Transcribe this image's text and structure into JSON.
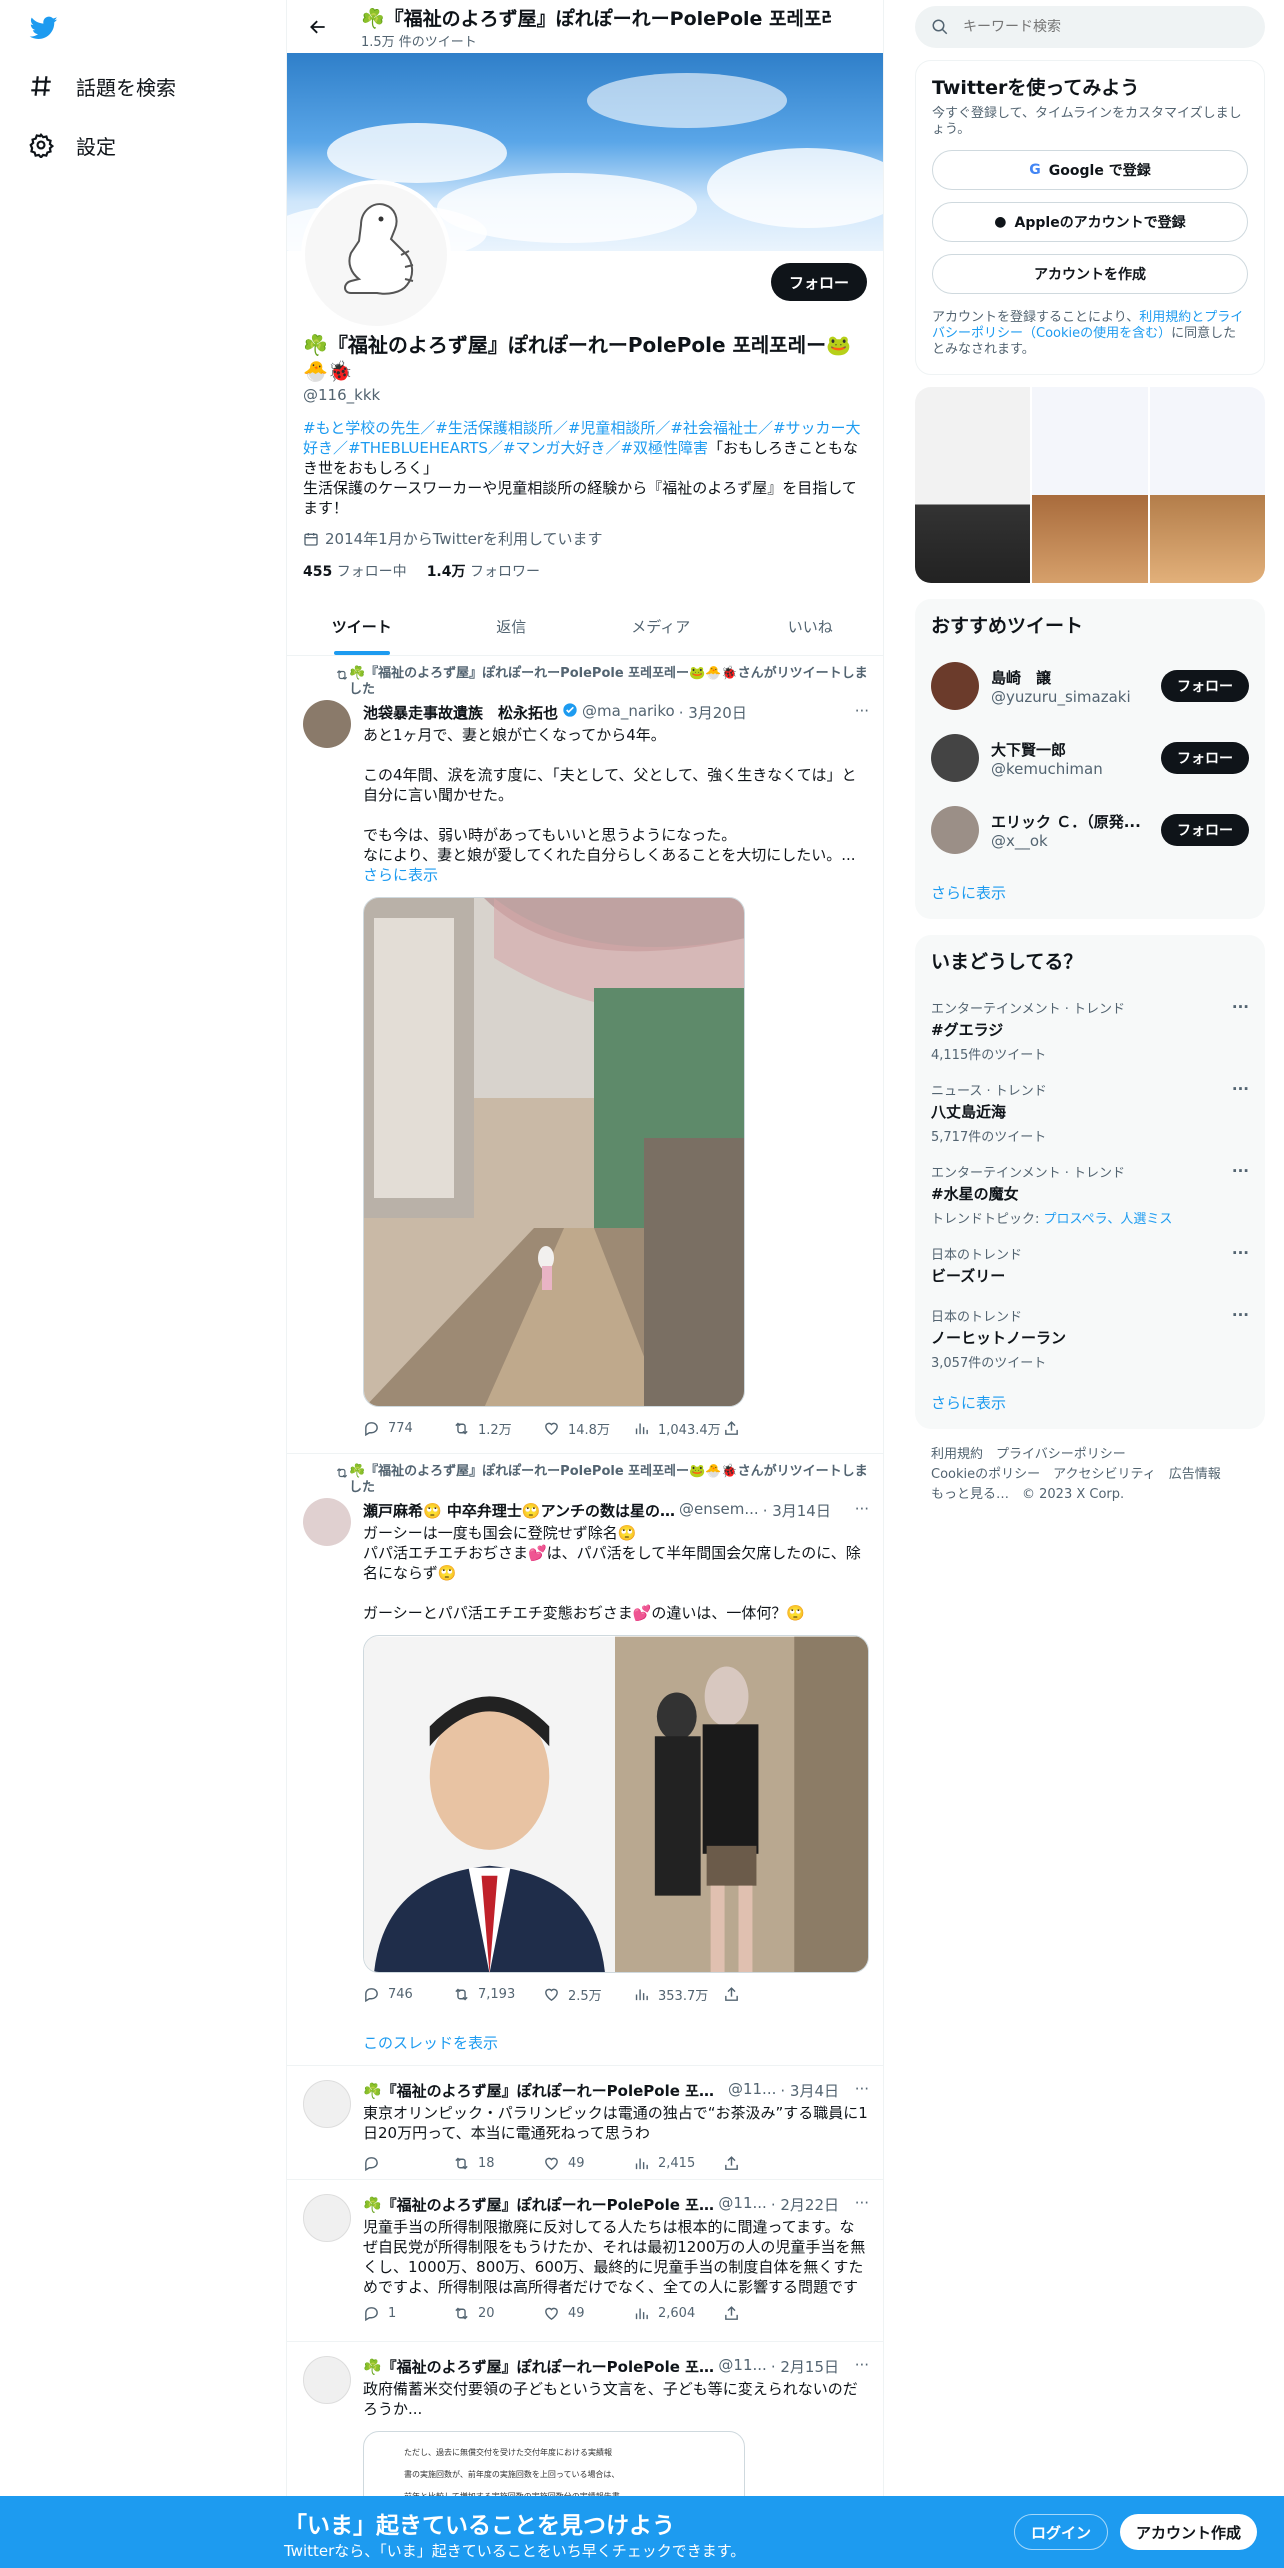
{
  "nav": {
    "explore_label": "話題を検索",
    "settings_label": "設定"
  },
  "header": {
    "name": "☘️『福祉のよろず屋』ぽれぽーれーPolePole 포레포레ー",
    "tweet_count": "1.5万 件のツイート"
  },
  "profile": {
    "name": "☘️『福祉のよろず屋』ぽれぽーれーPolePole 포레포레ー🐸🐣🐞",
    "handle": "@116_kkk",
    "bio_tags": "#もと学校の先生／#生活保護相談所／#児童相談所／#社会福祉士／#サッカー大好き／#THEBLUEHEARTS／#マンガ大好き／#双極性障害",
    "bio_quote": "「おもしろきこともなき世をおもしろく」",
    "bio_text": "生活保護のケースワーカーや児童相談所の経験から『福祉のよろず屋』を目指してます！",
    "joined": "2014年1月からTwitterを利用しています",
    "following_count": "455",
    "following_label": "フォロー中",
    "followers_count": "1.4万",
    "followers_label": "フォロワー",
    "follow_button": "フォロー"
  },
  "tabs": [
    "ツイート",
    "返信",
    "メディア",
    "いいね"
  ],
  "tweets": [
    {
      "retweet_by": "☘️『福祉のよろず屋』ぽれぽーれーPolePole 포레포레ー🐸🐣🐞さんがリツイートしました",
      "name": "池袋暴走事故遺族　松永拓也",
      "handle": "@ma_nariko",
      "date": "· 3月20日",
      "text": "あと1ヶ月で、妻と娘が亡くなってから4年。\n\nこの4年間、涙を流す度に、「夫として、父として、強く生きなくては」と自分に言い聞かせた。\n\nでも今は、弱い時があってもいいと思うようになった。\nなにより、妻と娘が愛してくれた自分らしくあることを大切にしたい。...",
      "show_more": "さらに表示",
      "replies": "774",
      "retweets": "1.2万",
      "likes": "14.8万",
      "views": "1,043.4万"
    },
    {
      "retweet_by": "☘️『福祉のよろず屋』ぽれぽーれーPolePole 포레포레ー🐸🐣🐞さんがリツイートしました",
      "name": "瀬戸麻希🙄 中卒弁理士🙄アンチの数は星の…",
      "handle": "@ensem...",
      "date": "· 3月14日",
      "text": "ガーシーは一度も国会に登院せず除名🙄\nパパ活エチエチおぢさま💕は、パパ活をして半年間国会欠席したのに、除名にならず🙄\n\nガーシーとパパ活エチエチ変態おぢさま💕の違いは、一体何？🙄",
      "replies": "746",
      "retweets": "7,193",
      "likes": "2.5万",
      "views": "353.7万",
      "thread_link": "このスレッドを表示"
    },
    {
      "name": "☘️『福祉のよろず屋』ぽれぽーれーPolePole 포레...",
      "handle": "@11...",
      "date": "· 3月4日",
      "text": "東京オリンピック・パラリンピックは電通の独占で“お茶汲み”する職員に1日20万円って、本当に電通死ねって思うわ",
      "replies": "",
      "retweets": "18",
      "likes": "49",
      "views": "2,415"
    },
    {
      "name": "☘️『福祉のよろず屋』ぽれぽーれーPolePole 포레...",
      "handle": "@11...",
      "date": "· 2月22日",
      "text": "児童手当の所得制限撤廃に反対してる人たちは根本的に間違ってます。なぜ自民党が所得制限をもうけたか、それは最初1200万の人の児童手当を無くし、1000万、800万、600万、最終的に児童手当の制度自体を無くすためですよ、所得制限は高所得者だけでなく、全ての人に影響する問題です",
      "replies": "1",
      "retweets": "20",
      "likes": "49",
      "views": "2,604"
    },
    {
      "name": "☘️『福祉のよろず屋』ぽれぽーれーPolePole 포레...",
      "handle": "@11...",
      "date": "· 2月15日",
      "text": "政府備蓄米交付要領の子どもという文言を、子ども等に変えられないのだろうか...",
      "doc_line1": "ただし、過去に無償交付を受けた交付年度における実績報",
      "doc_line2": "書の実施回数が、前年度の実施回数を上回っている場合は、",
      "doc_line3": "前年と比較して増加する実施回数の実施回数分の実績報告書"
    }
  ],
  "right": {
    "search_placeholder": "キーワード検索",
    "signup_title": "Twitterを使ってみよう",
    "signup_sub": "今すぐ登録して、タイムラインをカスタマイズしましょう。",
    "google_btn": "Google で登録",
    "apple_btn": "Appleのアカウントで登録",
    "create_btn": "アカウントを作成",
    "terms_pre": "アカウントを登録することにより、",
    "terms_link": "利用規約とプライバシーポリシー（Cookieの使用を含む）",
    "terms_post": "に同意したとみなされます。",
    "recommend_title": "おすすめツイート",
    "recommend": [
      {
        "name": "島崎　譲",
        "handle": "@yuzuru_simazaki",
        "button": "フォロー"
      },
      {
        "name": "大下賢一郎",
        "handle": "@kemuchiman",
        "button": "フォロー"
      },
      {
        "name": "エリック Ｃ．（原発...",
        "handle": "@x__ok",
        "button": "フォロー"
      }
    ],
    "show_more": "さらに表示",
    "trends_title": "いまどうしてる？",
    "trends": [
      {
        "context": "エンターテインメント · トレンド",
        "name": "#グエラジ",
        "count": "4,115件のツイート"
      },
      {
        "context": "ニュース · トレンド",
        "name": "八丈島近海",
        "count": "5,717件のツイート"
      },
      {
        "context": "エンターテインメント · トレンド",
        "name": "#水星の魔女",
        "count": "トレンドトピック: ",
        "topics": "プロスペラ、人選ミス"
      },
      {
        "context": "日本のトレンド",
        "name": "ビーズリー",
        "count": ""
      },
      {
        "context": "日本のトレンド",
        "name": "ノーヒットノーラン",
        "count": "3,057件のツイート"
      }
    ],
    "trends_more": "さらに表示",
    "footer_line1": "利用規約　プライバシーポリシー",
    "footer_line2": "Cookieのポリシー　アクセシビリティ　広告情報",
    "footer_line3": "もっと見る…　© 2023 X Corp."
  },
  "bottombar": {
    "title": "「いま」起きていることを見つけよう",
    "subtitle": "Twitterなら、「いま」起きていることをいち早くチェックできます。",
    "login": "ログイン",
    "signup": "アカウント作成"
  },
  "colors": {
    "accent": "#1d9bf0",
    "text": "#0f1419",
    "muted": "#536471"
  }
}
